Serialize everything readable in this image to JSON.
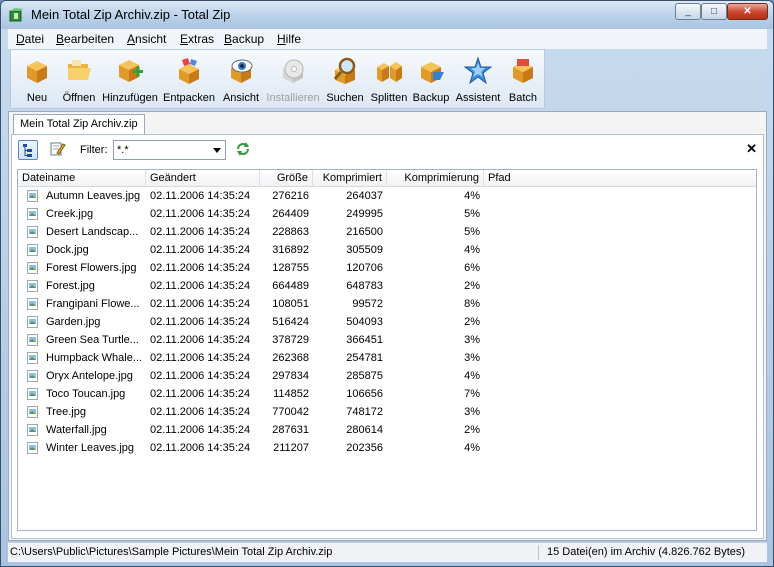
{
  "window": {
    "title": "Mein Total Zip Archiv.zip - Total Zip",
    "controls": {
      "minimize": "_",
      "maximize": "□",
      "close": "✕"
    }
  },
  "menu": [
    {
      "label": "Datei"
    },
    {
      "label": "Bearbeiten"
    },
    {
      "label": "Ansicht"
    },
    {
      "label": "Extras"
    },
    {
      "label": "Backup"
    },
    {
      "label": "Hilfe"
    }
  ],
  "toolbar": [
    {
      "label": "Neu",
      "icon": "new-box-icon",
      "enabled": true
    },
    {
      "label": "Öffnen",
      "icon": "open-folder-icon",
      "enabled": true
    },
    {
      "label": "Hinzufügen",
      "icon": "add-box-icon",
      "enabled": true
    },
    {
      "label": "Entpacken",
      "icon": "extract-box-icon",
      "enabled": true
    },
    {
      "label": "Ansicht",
      "icon": "view-eye-icon",
      "enabled": true
    },
    {
      "label": "Installieren",
      "icon": "install-cd-icon",
      "enabled": false
    },
    {
      "label": "Suchen",
      "icon": "search-magnifier-icon",
      "enabled": true
    },
    {
      "label": "Splitten",
      "icon": "split-box-icon",
      "enabled": true
    },
    {
      "label": "Backup",
      "icon": "backup-box-icon",
      "enabled": true
    },
    {
      "label": "Assistent",
      "icon": "wizard-star-icon",
      "enabled": true
    },
    {
      "label": "Batch",
      "icon": "batch-box-icon",
      "enabled": true
    }
  ],
  "document_tab": "Mein Total Zip Archiv.zip",
  "filter": {
    "label": "Filter:",
    "value": "*.*"
  },
  "panel_close": "✕",
  "table": {
    "columns": [
      "Dateiname",
      "Geändert",
      "Größe",
      "Komprimiert",
      "Komprimierung",
      "Pfad"
    ],
    "rows": [
      [
        "Autumn Leaves.jpg",
        "02.11.2006 14:35:24",
        "276216",
        "264037",
        "4%",
        ""
      ],
      [
        "Creek.jpg",
        "02.11.2006 14:35:24",
        "264409",
        "249995",
        "5%",
        ""
      ],
      [
        "Desert Landscap...",
        "02.11.2006 14:35:24",
        "228863",
        "216500",
        "5%",
        ""
      ],
      [
        "Dock.jpg",
        "02.11.2006 14:35:24",
        "316892",
        "305509",
        "4%",
        ""
      ],
      [
        "Forest Flowers.jpg",
        "02.11.2006 14:35:24",
        "128755",
        "120706",
        "6%",
        ""
      ],
      [
        "Forest.jpg",
        "02.11.2006 14:35:24",
        "664489",
        "648783",
        "2%",
        ""
      ],
      [
        "Frangipani Flowe...",
        "02.11.2006 14:35:24",
        "108051",
        "99572",
        "8%",
        ""
      ],
      [
        "Garden.jpg",
        "02.11.2006 14:35:24",
        "516424",
        "504093",
        "2%",
        ""
      ],
      [
        "Green Sea Turtle...",
        "02.11.2006 14:35:24",
        "378729",
        "366451",
        "3%",
        ""
      ],
      [
        "Humpback Whale...",
        "02.11.2006 14:35:24",
        "262368",
        "254781",
        "3%",
        ""
      ],
      [
        "Oryx Antelope.jpg",
        "02.11.2006 14:35:24",
        "297834",
        "285875",
        "4%",
        ""
      ],
      [
        "Toco Toucan.jpg",
        "02.11.2006 14:35:24",
        "114852",
        "106656",
        "7%",
        ""
      ],
      [
        "Tree.jpg",
        "02.11.2006 14:35:24",
        "770042",
        "748172",
        "3%",
        ""
      ],
      [
        "Waterfall.jpg",
        "02.11.2006 14:35:24",
        "287631",
        "280614",
        "2%",
        ""
      ],
      [
        "Winter Leaves.jpg",
        "02.11.2006 14:35:24",
        "211207",
        "202356",
        "4%",
        ""
      ]
    ]
  },
  "status": {
    "path": "C:\\Users\\Public\\Pictures\\Sample Pictures\\Mein Total Zip Archiv.zip",
    "summary": "15  Datei(en) im Archiv (4.826.762 Bytes)"
  }
}
